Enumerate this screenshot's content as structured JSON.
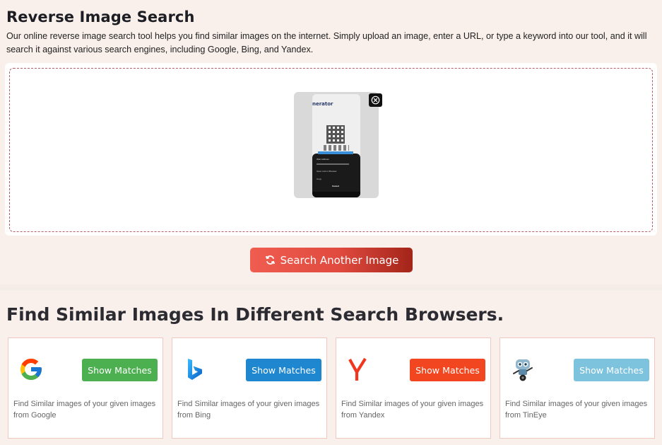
{
  "header": {
    "title": "Reverse Image Search",
    "description": "Our online reverse image search tool helps you find similar images on the internet. Simply upload an image, enter a URL, or type a keyword into our tool, and it will search it against various search engines, including Google, Bing, and Yandex."
  },
  "upload": {
    "thumbnail_icon": "uploaded-phone-screenshot",
    "thumbnail_text": {
      "brand": "nerator",
      "dialog_title": "Web Address",
      "dialog_item_1": "Open Link in Browser",
      "dialog_item_2": "Copy",
      "dialog_action": "Cancel"
    },
    "remove_icon": "circle-x-icon",
    "search_another_label": "Search Another Image",
    "search_another_icon": "refresh-icon"
  },
  "engines_section": {
    "heading": "Find Similar Images In Different Search Browsers.",
    "engines": [
      {
        "name": "Google",
        "icon": "google-icon",
        "button_label": "Show Matches",
        "button_color": "#4caf50",
        "description": "Find Similar images of your given images from Google"
      },
      {
        "name": "Bing",
        "icon": "bing-icon",
        "button_label": "Show Matches",
        "button_color": "#1f87cf",
        "description": "Find Similar images of your given images from Bing"
      },
      {
        "name": "Yandex",
        "icon": "yandex-icon",
        "button_label": "Show Matches",
        "button_color": "#f1461f",
        "description": "Find Similar images of your given images from Yandex"
      },
      {
        "name": "TinEye",
        "icon": "tineye-robot-icon",
        "button_label": "Show Matches",
        "button_color": "#7ec3de",
        "description": "Find Similar images of your given images from TinEye"
      }
    ]
  }
}
